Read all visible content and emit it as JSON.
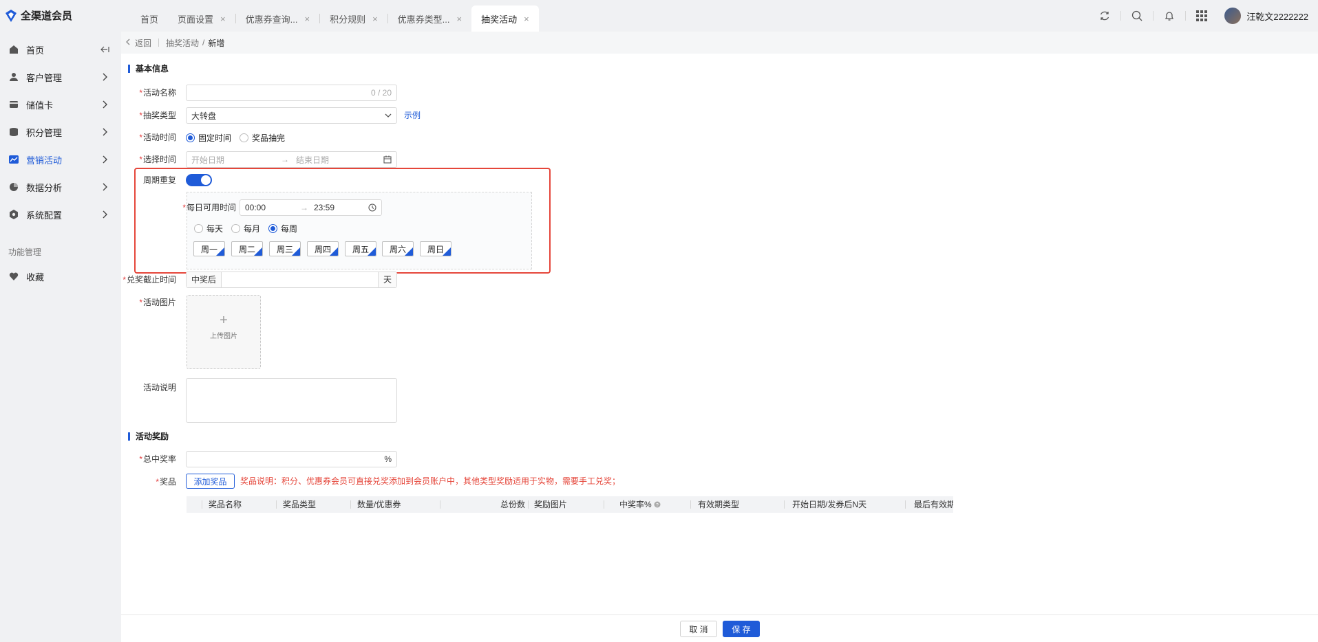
{
  "app": {
    "title": "全渠道会员"
  },
  "tabs": [
    {
      "label": "首页",
      "closable": false
    },
    {
      "label": "页面设置",
      "closable": true
    },
    {
      "label": "优惠券查询...",
      "closable": true
    },
    {
      "label": "积分规则",
      "closable": true
    },
    {
      "label": "优惠券类型...",
      "closable": true
    },
    {
      "label": "抽奖活动",
      "closable": true,
      "active": true
    }
  ],
  "tab_close_glyph": "×",
  "user": {
    "name": "汪乾文2222222"
  },
  "sidebar": {
    "items": [
      {
        "label": "首页",
        "icon": "home-icon"
      },
      {
        "label": "客户管理",
        "icon": "users-icon"
      },
      {
        "label": "储值卡",
        "icon": "card-icon"
      },
      {
        "label": "积分管理",
        "icon": "points-icon"
      },
      {
        "label": "营销活动",
        "icon": "chart-icon",
        "active": true
      },
      {
        "label": "数据分析",
        "icon": "pie-icon"
      },
      {
        "label": "系统配置",
        "icon": "settings-icon"
      }
    ],
    "group_label": "功能管理",
    "favorites": {
      "label": "收藏",
      "icon": "heart-icon"
    }
  },
  "breadcrumb": {
    "back": "返回",
    "parent": "抽奖活动",
    "separator": "/",
    "current": "新增"
  },
  "basic": {
    "section_title": "基本信息",
    "name": {
      "label": "活动名称",
      "value": "",
      "counter": "0 / 20"
    },
    "type": {
      "label": "抽奖类型",
      "value": "大转盘",
      "example_link": "示例"
    },
    "time_mode": {
      "label": "活动时间",
      "options": [
        "固定时间",
        "奖品抽完"
      ],
      "selected": "固定时间"
    },
    "date_range": {
      "label": "选择时间",
      "start_placeholder": "开始日期",
      "end_placeholder": "结束日期",
      "arrow": "→"
    },
    "repeat": {
      "label": "周期重复",
      "enabled": true
    },
    "daily_time": {
      "label": "每日可用时间",
      "start": "00:00",
      "end": "23:59",
      "arrow": "→"
    },
    "period": {
      "options": [
        "每天",
        "每月",
        "每周"
      ],
      "selected": "每周"
    },
    "weekdays": [
      "周一",
      "周二",
      "周三",
      "周四",
      "周五",
      "周六",
      "周日"
    ],
    "redeem_deadline": {
      "label": "兑奖截止时间",
      "prefix": "中奖后",
      "value": "",
      "suffix": "天"
    },
    "image": {
      "label": "活动图片",
      "plus": "+",
      "upload_text": "上传图片"
    },
    "description": {
      "label": "活动说明",
      "value": ""
    }
  },
  "reward": {
    "section_title": "活动奖励",
    "rate": {
      "label": "总中奖率",
      "value": "",
      "suffix": "%"
    },
    "prize": {
      "label": "奖品",
      "add_button": "添加奖品",
      "note": "奖品说明：积分、优惠券会员可直接兑奖添加到会员账户中，其他类型奖励适用于实物，需要手工兑奖；"
    },
    "table_headers": [
      "奖品名称",
      "奖品类型",
      "数量/优惠券",
      "总份数",
      "奖励图片",
      "中奖率%",
      "有效期类型",
      "开始日期/发券后N天",
      "最后有效期/"
    ]
  },
  "footer": {
    "cancel": "取 消",
    "save": "保 存"
  },
  "colors": {
    "primary": "#1f5bd8",
    "highlight": "#e5463a",
    "required": "#e23c3c"
  }
}
